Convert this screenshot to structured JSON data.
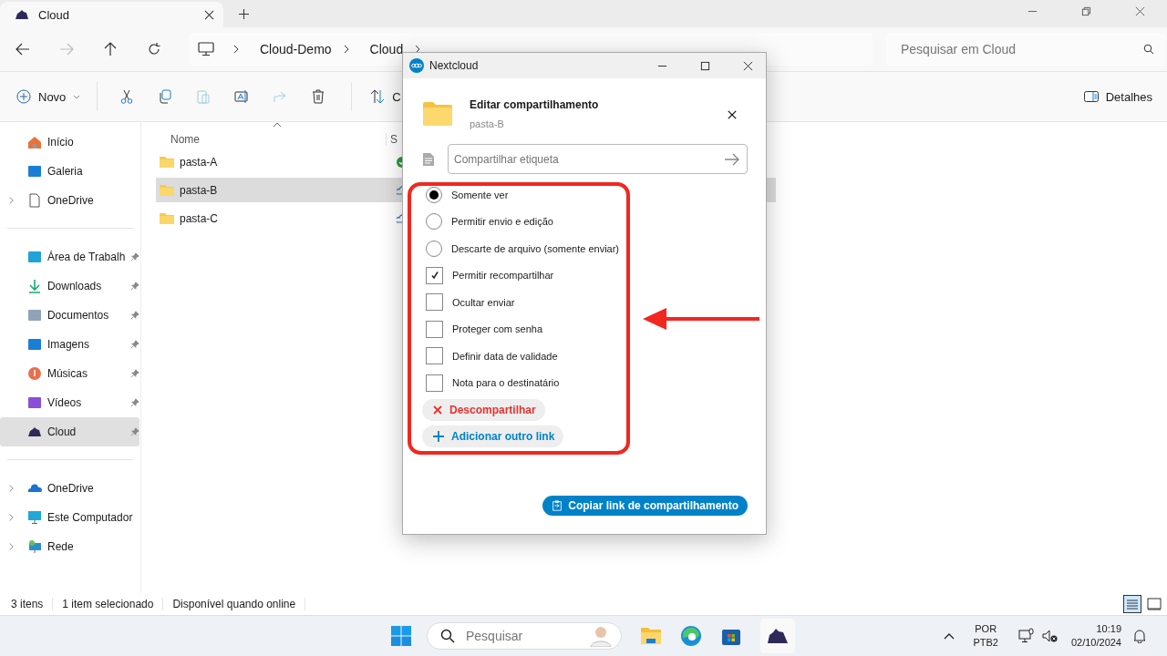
{
  "tab": {
    "title": "Cloud"
  },
  "nav": {
    "breadcrumb": [
      "Cloud-Demo",
      "Cloud"
    ],
    "search": {
      "placeholder": "Pesquisar em Cloud"
    }
  },
  "toolbar": {
    "new_label": "Novo",
    "sort_label": "C",
    "details_label": "Detalhes"
  },
  "sidebar": {
    "top": [
      {
        "label": "Início",
        "expandable": false
      },
      {
        "label": "Galeria",
        "expandable": false
      },
      {
        "label": "OneDrive",
        "expandable": true
      }
    ],
    "quick": [
      {
        "label": "Área de Trabalh",
        "selected": false
      },
      {
        "label": "Downloads",
        "selected": false
      },
      {
        "label": "Documentos",
        "selected": false
      },
      {
        "label": "Imagens",
        "selected": false
      },
      {
        "label": "Músicas",
        "selected": false
      },
      {
        "label": "Vídeos",
        "selected": false
      },
      {
        "label": "Cloud",
        "selected": true
      }
    ],
    "bottom": [
      {
        "label": "OneDrive"
      },
      {
        "label": "Este Computador"
      },
      {
        "label": "Rede"
      }
    ]
  },
  "files": {
    "columns": [
      "Nome",
      "S"
    ],
    "rows": [
      {
        "name": "pasta-A",
        "selected": false,
        "kind": "synced"
      },
      {
        "name": "pasta-B",
        "selected": true,
        "kind": "cloud"
      },
      {
        "name": "pasta-C",
        "selected": false,
        "kind": "cloud"
      }
    ]
  },
  "status_bar": [
    "3 itens",
    "1 item selecionado",
    "Disponível quando online"
  ],
  "dialog": {
    "title": "Nextcloud",
    "heading": "Editar compartilhamento",
    "subtitle": "pasta-B",
    "label_field": {
      "placeholder": "Compartilhar etiqueta"
    },
    "options": [
      {
        "kind": "radio",
        "label": "Somente ver",
        "selected": true
      },
      {
        "kind": "radio",
        "label": "Permitir envio e edição",
        "selected": false
      },
      {
        "kind": "radio",
        "label": "Descarte de arquivo (somente enviar)",
        "selected": false
      },
      {
        "kind": "checkbox",
        "label": "Permitir recompartilhar",
        "checked": true
      },
      {
        "kind": "checkbox",
        "label": "Ocultar enviar",
        "checked": false
      },
      {
        "kind": "checkbox",
        "label": "Proteger com senha",
        "checked": false
      },
      {
        "kind": "checkbox",
        "label": "Definir data de validade",
        "checked": false
      },
      {
        "kind": "checkbox",
        "label": "Nota para o destinatário",
        "checked": false
      }
    ],
    "unshare_label": "Descompartilhar",
    "add_link_label": "Adicionar outro link",
    "copy_link_label": "Copiar link de compartilhamento"
  },
  "taskbar": {
    "search": {
      "placeholder": "Pesquisar"
    },
    "language": [
      "POR",
      "PTB2"
    ],
    "time": "10:19",
    "date": "02/10/2024"
  }
}
